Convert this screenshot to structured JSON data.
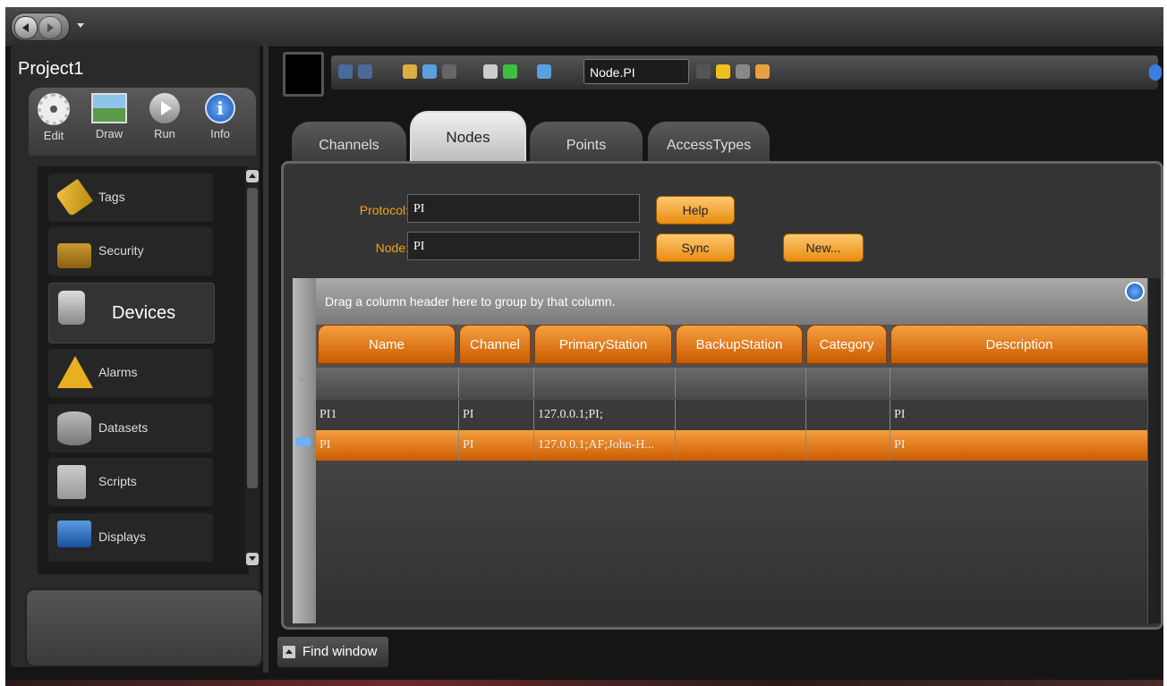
{
  "project": {
    "title": "Project1"
  },
  "modes": [
    {
      "label": "Edit",
      "icon": "gear-icon"
    },
    {
      "label": "Draw",
      "icon": "picture-icon"
    },
    {
      "label": "Run",
      "icon": "play-icon"
    },
    {
      "label": "Info",
      "icon": "info-icon"
    }
  ],
  "nav": {
    "items": [
      {
        "label": "Tags",
        "icon": "tag-icon"
      },
      {
        "label": "Security",
        "icon": "lock-icon"
      },
      {
        "label": "Devices",
        "icon": "device-icon"
      },
      {
        "label": "Alarms",
        "icon": "alarm-icon"
      },
      {
        "label": "Datasets",
        "icon": "database-icon"
      },
      {
        "label": "Scripts",
        "icon": "script-icon"
      },
      {
        "label": "Displays",
        "icon": "display-icon"
      }
    ],
    "active": "Devices"
  },
  "toolbar": {
    "search_value": "Node.PI"
  },
  "tabs": [
    {
      "label": "Channels"
    },
    {
      "label": "Nodes"
    },
    {
      "label": "Points"
    },
    {
      "label": "AccessTypes"
    }
  ],
  "active_tab": "Nodes",
  "form": {
    "protocol_label": "Protocol:",
    "protocol_value": "PI",
    "node_label": "Node:",
    "node_value": "PI",
    "help_label": "Help",
    "sync_label": "Sync",
    "new_label": "New..."
  },
  "grid": {
    "group_hint": "Drag a column header here to group by that column.",
    "columns": [
      "Name",
      "Channel",
      "PrimaryStation",
      "BackupStation",
      "Category",
      "Description"
    ],
    "rows": [
      [
        "PI1",
        "PI",
        "127.0.0.1;PI;",
        "",
        "",
        "PI"
      ],
      [
        "PI",
        "PI",
        "127.0.0.1;AF;John-H...",
        "",
        "",
        "PI"
      ]
    ],
    "selected_row": 1
  },
  "find_window": {
    "label": "Find window"
  },
  "colors": {
    "accent": "#e88c10",
    "panel": "#343434",
    "label": "#f0a020"
  }
}
